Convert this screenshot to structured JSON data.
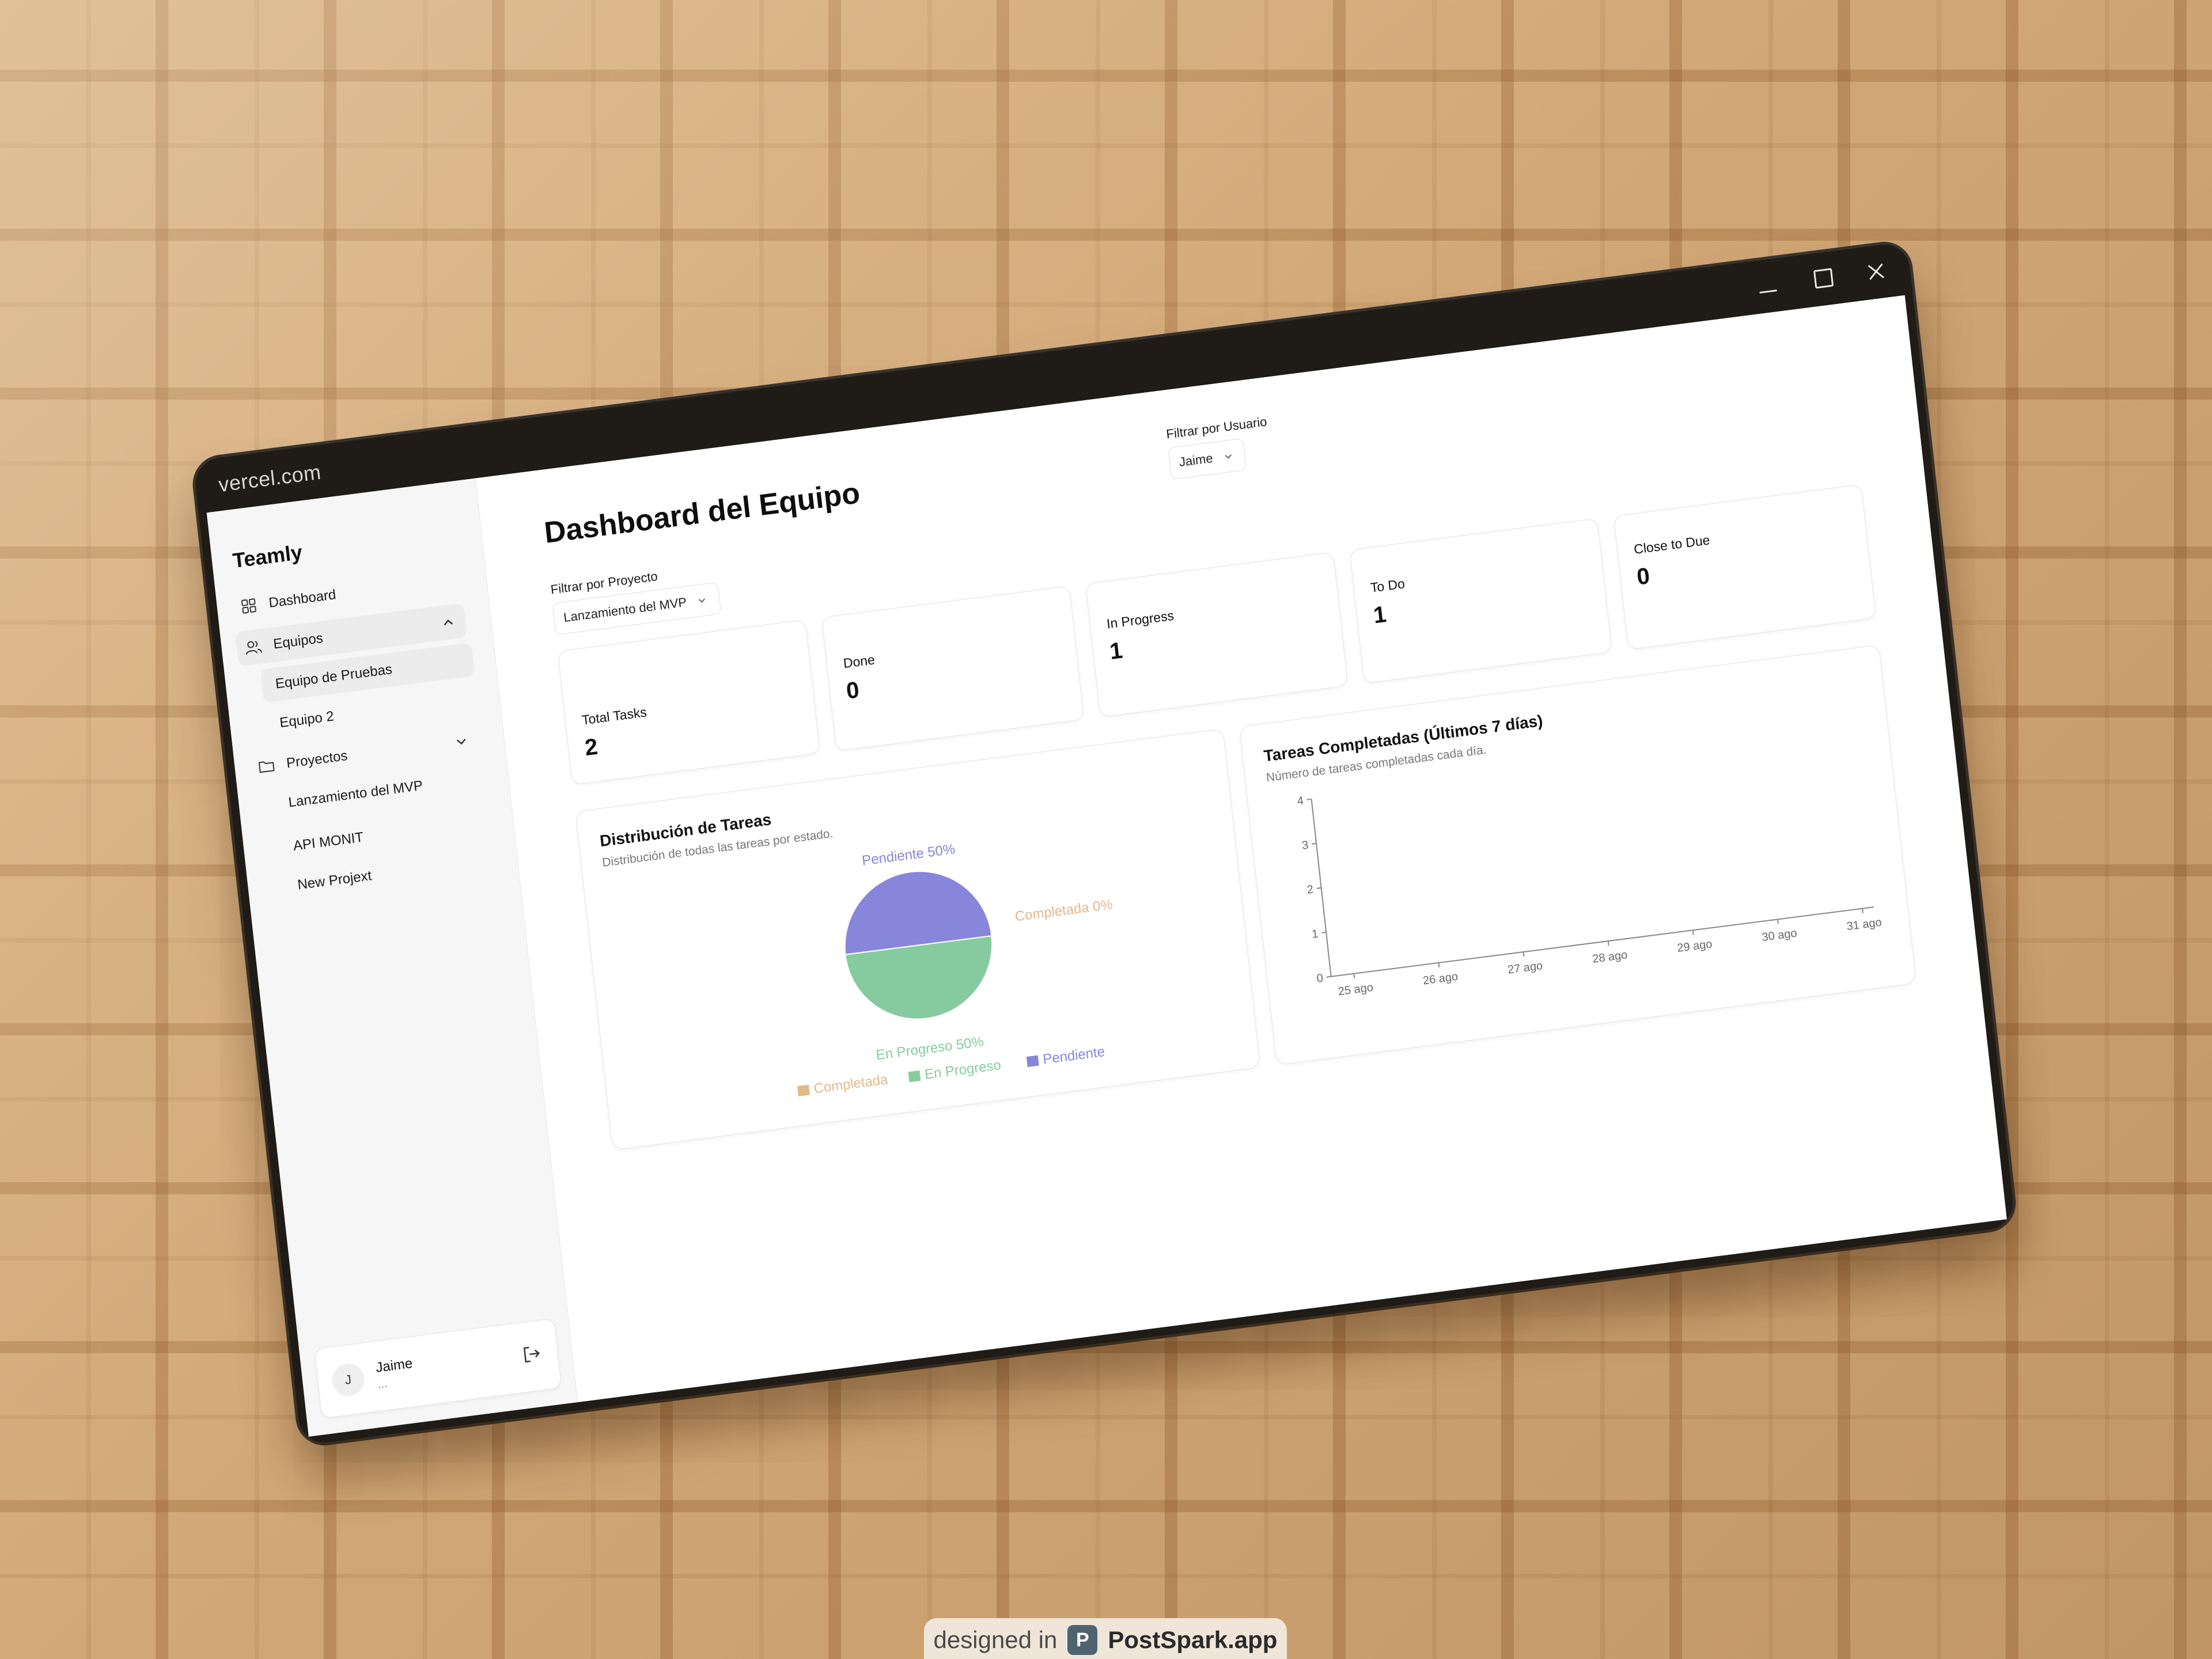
{
  "browser": {
    "url": "vercel.com"
  },
  "sidebar": {
    "brand": "Teamly",
    "nav": {
      "dashboard": "Dashboard",
      "equipos": "Equipos",
      "proyectos": "Proyectos"
    },
    "teams": [
      "Equipo de Pruebas",
      "Equipo 2"
    ],
    "projects": [
      "Lanzamiento del MVP",
      "API MONIT",
      "New Projext"
    ],
    "user": {
      "initial": "J",
      "name": "Jaime",
      "sub": "..."
    }
  },
  "main": {
    "title": "Dashboard del Equipo",
    "filters": {
      "project_label": "Filtrar por Proyecto",
      "project_value": "Lanzamiento del MVP",
      "user_label": "Filtrar por Usuario",
      "user_value": "Jaime"
    },
    "stats": [
      {
        "label": "Total Tasks",
        "value": "2"
      },
      {
        "label": "Done",
        "value": "0"
      },
      {
        "label": "In Progress",
        "value": "1"
      },
      {
        "label": "To Do",
        "value": "1"
      },
      {
        "label": "Close to Due",
        "value": "0"
      }
    ]
  },
  "chart_data": [
    {
      "type": "pie",
      "title": "Distribución de Tareas",
      "subtitle": "Distribución de todas las tareas por estado.",
      "slices": [
        {
          "name": "Completada",
          "value": 0,
          "percent_label": "Completada 0%",
          "color": "#e2b98a"
        },
        {
          "name": "En Progreso",
          "value": 1,
          "percent_label": "En Progreso 50%",
          "color": "#86cb9f"
        },
        {
          "name": "Pendiente",
          "value": 1,
          "percent_label": "Pendiente 50%",
          "color": "#8886da"
        }
      ],
      "legend": [
        "Completada",
        "En Progreso",
        "Pendiente"
      ],
      "legend_position": "bottom"
    },
    {
      "type": "line",
      "title": "Tareas Completadas (Últimos 7 días)",
      "subtitle": "Número de tareas completadas cada día.",
      "categories": [
        "25 ago",
        "26 ago",
        "27 ago",
        "28 ago",
        "29 ago",
        "30 ago",
        "31 ago"
      ],
      "series": [
        {
          "values": [
            0,
            0,
            0,
            0,
            0,
            0,
            0
          ],
          "color": "#8886da"
        }
      ],
      "ylim": [
        0,
        4
      ],
      "yticks": [
        "0",
        "1",
        "2",
        "3",
        "4"
      ],
      "grid": false
    }
  ],
  "badge": {
    "prefix": "designed in",
    "logo_letter": "P",
    "brand": "PostSpark.app"
  }
}
